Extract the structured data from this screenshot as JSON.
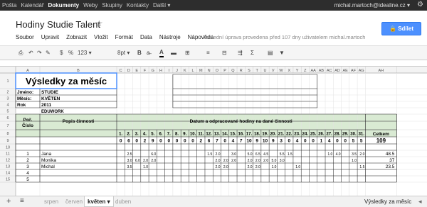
{
  "topbar": {
    "nav": [
      "Pošta",
      "Kalendář",
      "Dokumenty",
      "Weby",
      "Skupiny",
      "Kontakty",
      "Další ▾"
    ],
    "active_nav": "Dokumenty",
    "user_email": "michal.martoch@idealine.cz ▾"
  },
  "doc": {
    "title": "Hodiny Studie Talent",
    "share_label": "Sdílet",
    "last_edit": "Poslední úprava provedena před 107 dny uživatelem michal.martoch"
  },
  "menu": [
    "Soubor",
    "Upravit",
    "Zobrazit",
    "Vložit",
    "Formát",
    "Data",
    "Nástroje",
    "Nápověda"
  ],
  "toolbar": {
    "currency": "$",
    "percent": "%",
    "number_format": "123 ▾",
    "font_size": "8pt ▾",
    "bold": "B",
    "text_color": "A",
    "sigma": "Σ"
  },
  "columns": [
    "A",
    "B",
    "C",
    "D",
    "E",
    "F",
    "G",
    "H",
    "I",
    "J",
    "K",
    "L",
    "M",
    "N",
    "O",
    "P",
    "Q",
    "R",
    "S",
    "T",
    "U",
    "V",
    "W",
    "X",
    "Y",
    "Z",
    "AA",
    "AB",
    "AC",
    "AD",
    "AE",
    "AF",
    "AG",
    "AH"
  ],
  "rows": [
    "1",
    "2",
    "3",
    "4",
    "5",
    "6",
    "7",
    "8",
    "9",
    "10",
    "11",
    "12",
    "13",
    "14",
    "15"
  ],
  "sheet": {
    "heading": "Výsledky za měsíc",
    "info_labels": [
      "Jméno:",
      "Měsíc:",
      "Rok"
    ],
    "info_values": [
      "STUDIE",
      "KVĚTEN",
      "2011"
    ],
    "company": "EDUWORK",
    "col_order": "Poř. Číslo",
    "col_activity": "Popis činnosti",
    "col_days": "Datum a odpracované hodiny na dané činnosti",
    "col_total": "Celkem",
    "days": [
      "1.",
      "2.",
      "3.",
      "4.",
      "5.",
      "6.",
      "7.",
      "8.",
      "9.",
      "10.",
      "11.",
      "12.",
      "13.",
      "14.",
      "15.",
      "16.",
      "17.",
      "18.",
      "19.",
      "20.",
      "21.",
      "22.",
      "23.",
      "24.",
      "25.",
      "26.",
      "27.",
      "28.",
      "29.",
      "30.",
      "31."
    ],
    "day_totals": [
      "0",
      "6",
      "0",
      "2",
      "9",
      "0",
      "0",
      "0",
      "0",
      "0",
      "2",
      "6",
      "7",
      "0",
      "4",
      "7",
      "10",
      "9",
      "10",
      "9",
      "3",
      "0",
      "4",
      "0",
      "0",
      "1",
      "4",
      "0",
      "0",
      "5",
      "5"
    ],
    "grand_total": "109",
    "people": [
      {
        "num": "1",
        "name": "Jana",
        "total": "48.5",
        "hours": [
          "",
          "2.5",
          "",
          "",
          "6.0",
          "",
          "",
          "",
          "",
          "",
          "",
          "1.5",
          "2.0",
          "",
          "3.0",
          "",
          "5.0",
          "6.5",
          "4.5",
          "",
          "5.5",
          "1.5",
          "",
          "",
          "",
          "",
          "1.0",
          "4.0",
          "",
          "3.5",
          "2.0"
        ]
      },
      {
        "num": "2",
        "name": "Monika",
        "total": "37",
        "hours": [
          "",
          "3.0",
          "6.0",
          "2.0",
          "2.0",
          "",
          "",
          "",
          "",
          "",
          "",
          "",
          "2.0",
          "2.0",
          "2.0",
          "",
          "2.0",
          "2.0",
          "2.0",
          "5.0",
          "3.0",
          "",
          "",
          "",
          "",
          "",
          "",
          "",
          "",
          "1.0",
          ""
        ]
      },
      {
        "num": "3",
        "name": "Michal",
        "total": "23.5",
        "hours": [
          "",
          "3.5",
          "",
          "1.0",
          "",
          "",
          "",
          "",
          "",
          "",
          "",
          "",
          "2.0",
          "2.0",
          "",
          "",
          "2.0",
          "2.0",
          "",
          "1.0",
          "",
          "",
          "1.0",
          "",
          "",
          "",
          "",
          "",
          "",
          "",
          "1.5"
        ]
      },
      {
        "num": "4",
        "name": "",
        "total": "",
        "hours": []
      },
      {
        "num": "5",
        "name": "",
        "total": "",
        "hours": []
      }
    ]
  },
  "tabs": {
    "add": "+",
    "list": "≡",
    "sheets": [
      "srpen",
      "červen",
      "květen ▾",
      "duben"
    ],
    "active": "květen ▾",
    "status": "Výsledky za měsíc"
  }
}
